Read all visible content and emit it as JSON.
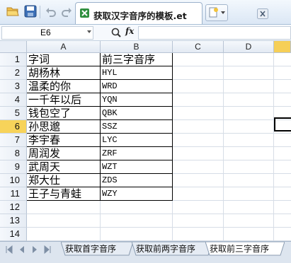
{
  "window": {
    "doc_title": "获取汉字音序的模板.et"
  },
  "formula_bar": {
    "name_box": "E6",
    "fx_label": "fx",
    "formula": ""
  },
  "columns": [
    "A",
    "B",
    "C",
    "D"
  ],
  "rows": [
    "1",
    "2",
    "3",
    "4",
    "5",
    "6",
    "7",
    "8",
    "9",
    "10",
    "11",
    "12",
    "13",
    "14"
  ],
  "table": [
    [
      "字词",
      "前三字音序"
    ],
    [
      "胡杨林",
      "HYL"
    ],
    [
      "温柔的你",
      "WRD"
    ],
    [
      "一千年以后",
      "YQN"
    ],
    [
      "钱包空了",
      "QBK"
    ],
    [
      "孙思邈",
      "SSZ"
    ],
    [
      "李宇春",
      "LYC"
    ],
    [
      "周润发",
      "ZRF"
    ],
    [
      "武周天",
      "WZT"
    ],
    [
      "郑大仕",
      "ZDS"
    ],
    [
      "王子与青蛙",
      "WZY"
    ]
  ],
  "active_row": "6",
  "sheet_tabs": [
    "获取首字音序",
    "获取前两字音序",
    "获取前三字音序"
  ],
  "active_sheet": "获取前三字音序",
  "colors": {
    "selection_header": "#f7d35a",
    "toolbar_bg": "#dbe7f5",
    "sheetbar_bg": "#dde5ef"
  }
}
